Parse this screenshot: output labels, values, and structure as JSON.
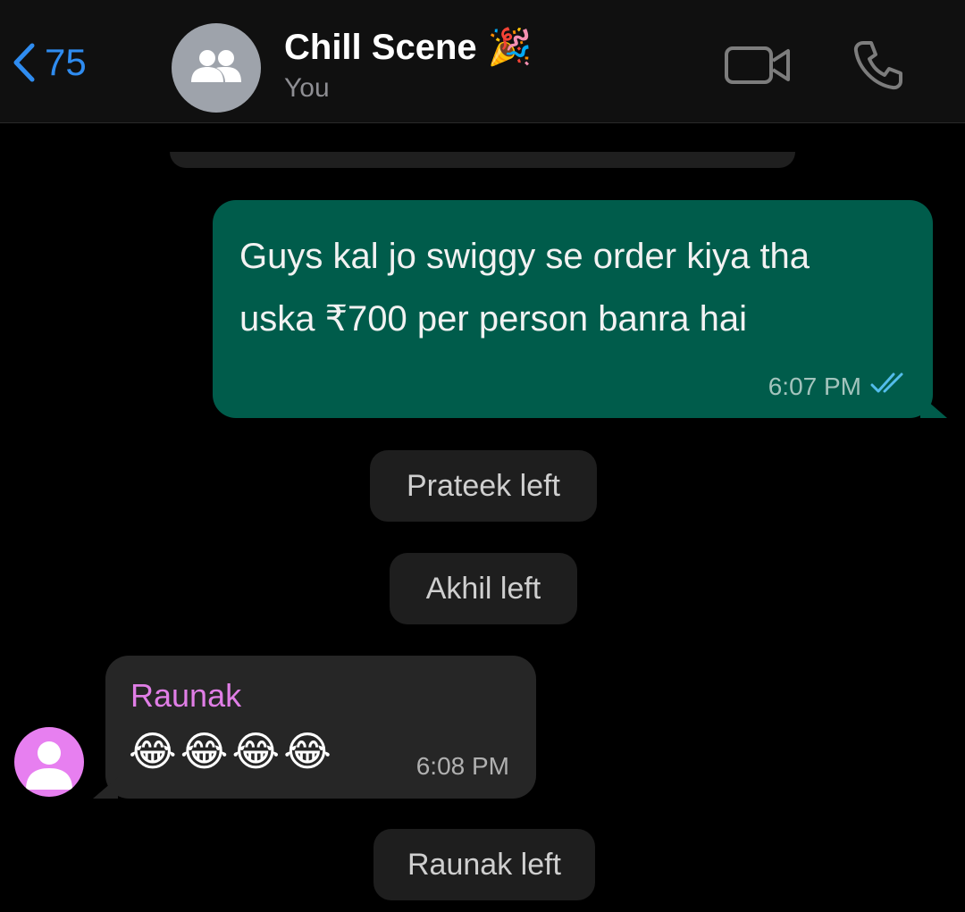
{
  "header": {
    "back_count": "75",
    "title": "Chill Scene",
    "title_emoji": "🎉",
    "subtitle": "You",
    "icons": [
      "chevron-left-icon",
      "group-icon",
      "video-call-icon",
      "phone-icon"
    ]
  },
  "messages": {
    "outgoing": {
      "text": "Guys kal jo swiggy se order kiya tha uska ₹700 per person banra hai",
      "time": "6:07 PM",
      "status": "read"
    },
    "system": [
      "Prateek left",
      "Akhil left",
      "Raunak left"
    ],
    "incoming": {
      "sender": "Raunak",
      "text": "😂😂😂😂",
      "time": "6:08 PM"
    }
  },
  "colors": {
    "header_bg": "#101010",
    "accent": "#2f8cf0",
    "outgoing_bubble": "#005c4b",
    "incoming_bubble": "#262626",
    "system_pill": "#1e1e1e",
    "sender_name": "#e07ee6",
    "read_ticks": "#53bdeb"
  }
}
